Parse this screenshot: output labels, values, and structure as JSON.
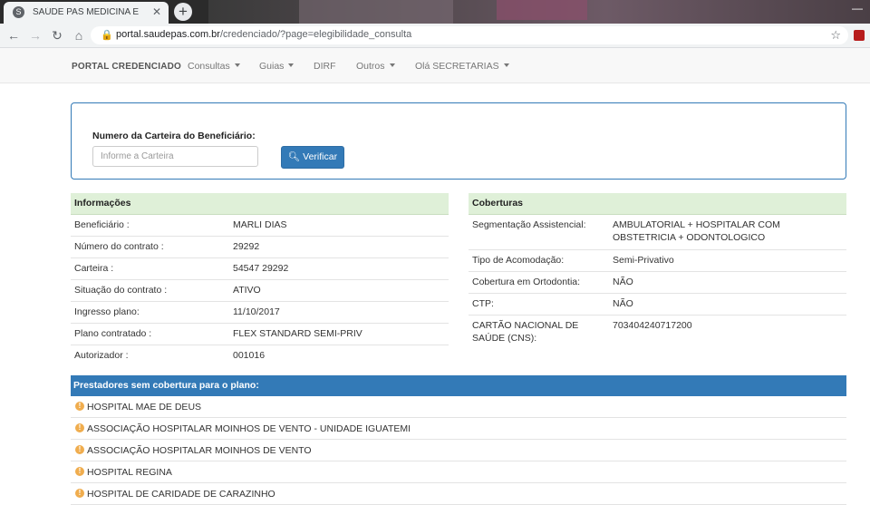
{
  "browser": {
    "tab_title": "SAÚDE PAS MEDICINA E ODONT",
    "new_tab_symbol": "+",
    "url_host": "portal.saudepas.com.br",
    "url_path": "/credenciado/?page=elegibilidade_consulta"
  },
  "navbar": {
    "brand": "PORTAL CREDENCIADO",
    "items": [
      {
        "label": "Consultas",
        "dropdown": true
      },
      {
        "label": "Guias",
        "dropdown": true
      },
      {
        "label": "DIRF",
        "dropdown": false
      },
      {
        "label": "Outros",
        "dropdown": true
      },
      {
        "label": "Olá SECRETARIAS",
        "dropdown": true
      }
    ]
  },
  "search": {
    "label": "Numero da Carteira do Beneficiário:",
    "placeholder": "Informe a Carteira",
    "button_label": "Verificar"
  },
  "informacoes": {
    "title": "Informações",
    "rows": [
      {
        "key": "Beneficiário :",
        "value": "MARLI DIAS"
      },
      {
        "key": "Número do contrato :",
        "value": "29292"
      },
      {
        "key": "Carteira :",
        "value": "54547 29292"
      },
      {
        "key": "Situação do contrato :",
        "value": "ATIVO"
      },
      {
        "key": "Ingresso plano:",
        "value": "11/10/2017"
      },
      {
        "key": "Plano contratado :",
        "value": "FLEX STANDARD SEMI-PRIV"
      },
      {
        "key": "Autorizador :",
        "value": "001016"
      }
    ]
  },
  "coberturas": {
    "title": "Coberturas",
    "rows": [
      {
        "key": "Segmentação Assistencial:",
        "value": "AMBULATORIAL + HOSPITALAR COM OBSTETRICIA + ODONTOLOGICO"
      },
      {
        "key": "Tipo de Acomodação:",
        "value": "Semi-Privativo"
      },
      {
        "key": "Cobertura em Ortodontia:",
        "value": "NÃO"
      },
      {
        "key": "CTP:",
        "value": "NÃO"
      },
      {
        "key": "CARTÃO NACIONAL DE SAÚDE (CNS):",
        "value": "703404240717200"
      }
    ]
  },
  "prestadores": {
    "title": "Prestadores sem cobertura para o plano:",
    "items": [
      "HOSPITAL MAE DE DEUS",
      "ASSOCIAÇÃO HOSPITALAR MOINHOS DE VENTO - UNIDADE IGUATEMI",
      "ASSOCIAÇÃO HOSPITALAR MOINHOS DE VENTO",
      "HOSPITAL REGINA",
      "HOSPITAL DE CARIDADE DE CARAZINHO"
    ]
  },
  "colors": {
    "primary": "#337ab7",
    "success_bg": "#dff0d8",
    "warning": "#f0ad4e"
  }
}
